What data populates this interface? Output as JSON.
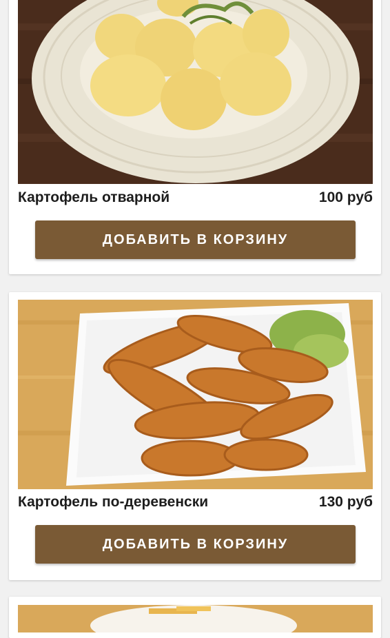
{
  "products": [
    {
      "name": "Картофель отварной",
      "price": "100 руб",
      "button_label": "ДОБАВИТЬ В КОРЗИНУ"
    },
    {
      "name": "Картофель по-деревенски",
      "price": "130 руб",
      "button_label": "ДОБАВИТЬ В КОРЗИНУ"
    }
  ],
  "colors": {
    "button": "#7a5a35",
    "card": "#ffffff",
    "background": "#f1f1f1"
  }
}
